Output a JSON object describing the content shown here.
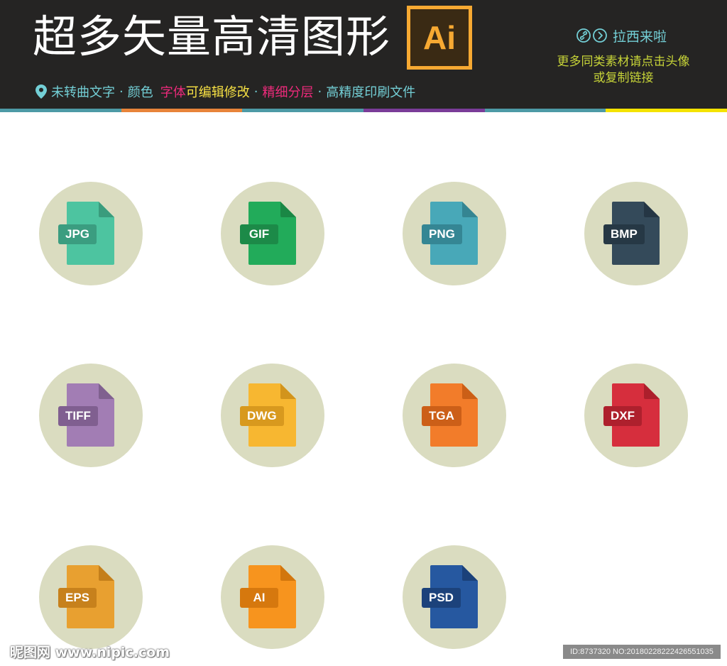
{
  "header": {
    "title": "超多矢量高清图形",
    "logo_text": "Ai",
    "features": {
      "part1": "未转曲文字",
      "sep": "·",
      "part2": "颜色",
      "part3a": "字体",
      "part3b": "可编辑修改",
      "part4": "精细分层",
      "part5": "高精度印刷文件"
    },
    "author": "拉西来啦",
    "promo_line1": "更多同类素材请点击头像",
    "promo_line2": "或复制链接",
    "divider_colors": [
      "#4d9aa6",
      "#e8843a",
      "#4d9aa6",
      "#7a3c98",
      "#4d9aa6",
      "#f4e300"
    ]
  },
  "icons": [
    {
      "label": "JPG",
      "body": "#4dc4a0",
      "fold": "#3a9c7d",
      "badge": "#3b9d80"
    },
    {
      "label": "GIF",
      "body": "#22ab5a",
      "fold": "#1a8745",
      "badge": "#1c8a48"
    },
    {
      "label": "PNG",
      "body": "#48a8b8",
      "fold": "#358592",
      "badge": "#358694"
    },
    {
      "label": "BMP",
      "body": "#344a5a",
      "fold": "#253644",
      "badge": "#263845"
    },
    {
      "label": "TIFF",
      "body": "#a27db4",
      "fold": "#80618f",
      "badge": "#805f90"
    },
    {
      "label": "DWG",
      "body": "#f7b731",
      "fold": "#d2941c",
      "badge": "#d8991e"
    },
    {
      "label": "TGA",
      "body": "#f27c2a",
      "fold": "#cb5f17",
      "badge": "#cc5f18"
    },
    {
      "label": "DXF",
      "body": "#d62e3d",
      "fold": "#ac1f2c",
      "badge": "#ae202d"
    },
    {
      "label": "EPS",
      "body": "#e8a030",
      "fold": "#c47f1b",
      "badge": "#c7811c"
    },
    {
      "label": "AI",
      "body": "#f7941e",
      "fold": "#d2760d",
      "badge": "#d6780e"
    },
    {
      "label": "PSD",
      "body": "#2658a0",
      "fold": "#1b417a",
      "badge": "#1c427b"
    }
  ],
  "footer": {
    "watermark": "昵图网 www.nipic.com",
    "id_text": "ID:8737320 NO:20180228222426551035"
  }
}
